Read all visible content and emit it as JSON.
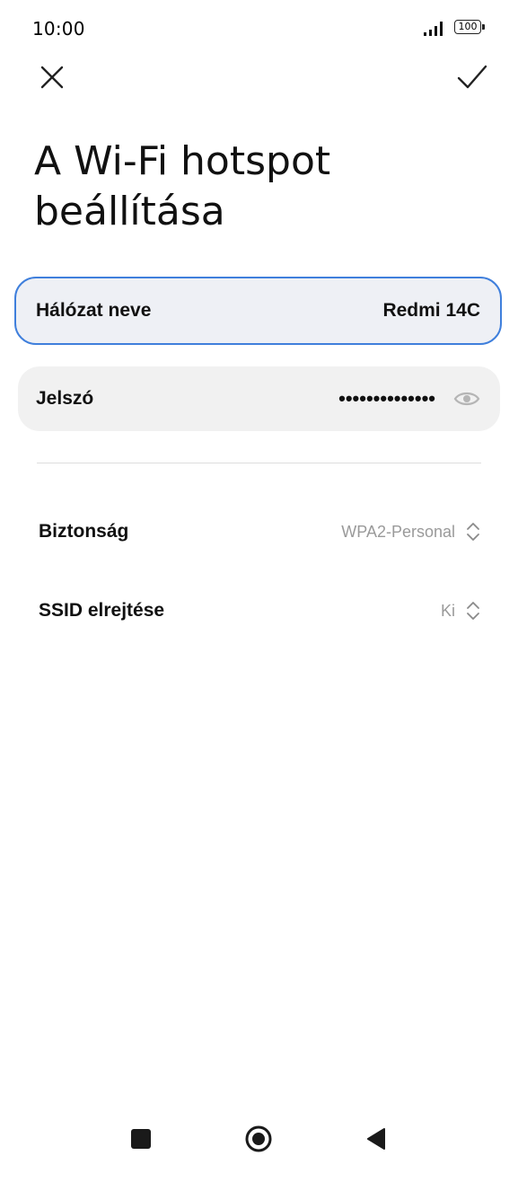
{
  "status_bar": {
    "time": "10:00",
    "battery_level": "100",
    "icons": [
      "signal-icon",
      "battery-icon"
    ]
  },
  "toolbar": {
    "close_icon": "close-icon",
    "confirm_icon": "checkmark-icon"
  },
  "page": {
    "title_line1": "A Wi-Fi hotspot",
    "title_line2": "beállítása"
  },
  "network_name": {
    "label": "Hálózat neve",
    "value": "Redmi 14C"
  },
  "password": {
    "label": "Jelszó",
    "masked_value": "••••••••••••••",
    "toggle_icon": "eye-icon"
  },
  "settings": {
    "security": {
      "label": "Biztonság",
      "value": "WPA2-Personal"
    },
    "hide_ssid": {
      "label": "SSID elrejtése",
      "value": "Ki"
    }
  },
  "navigation": {
    "icons": [
      "recents-icon",
      "home-icon",
      "back-icon"
    ]
  },
  "colors": {
    "accent": "#3f7fdc",
    "field_background": "#f1f1f1",
    "secondary_text": "#9a9a9a"
  }
}
